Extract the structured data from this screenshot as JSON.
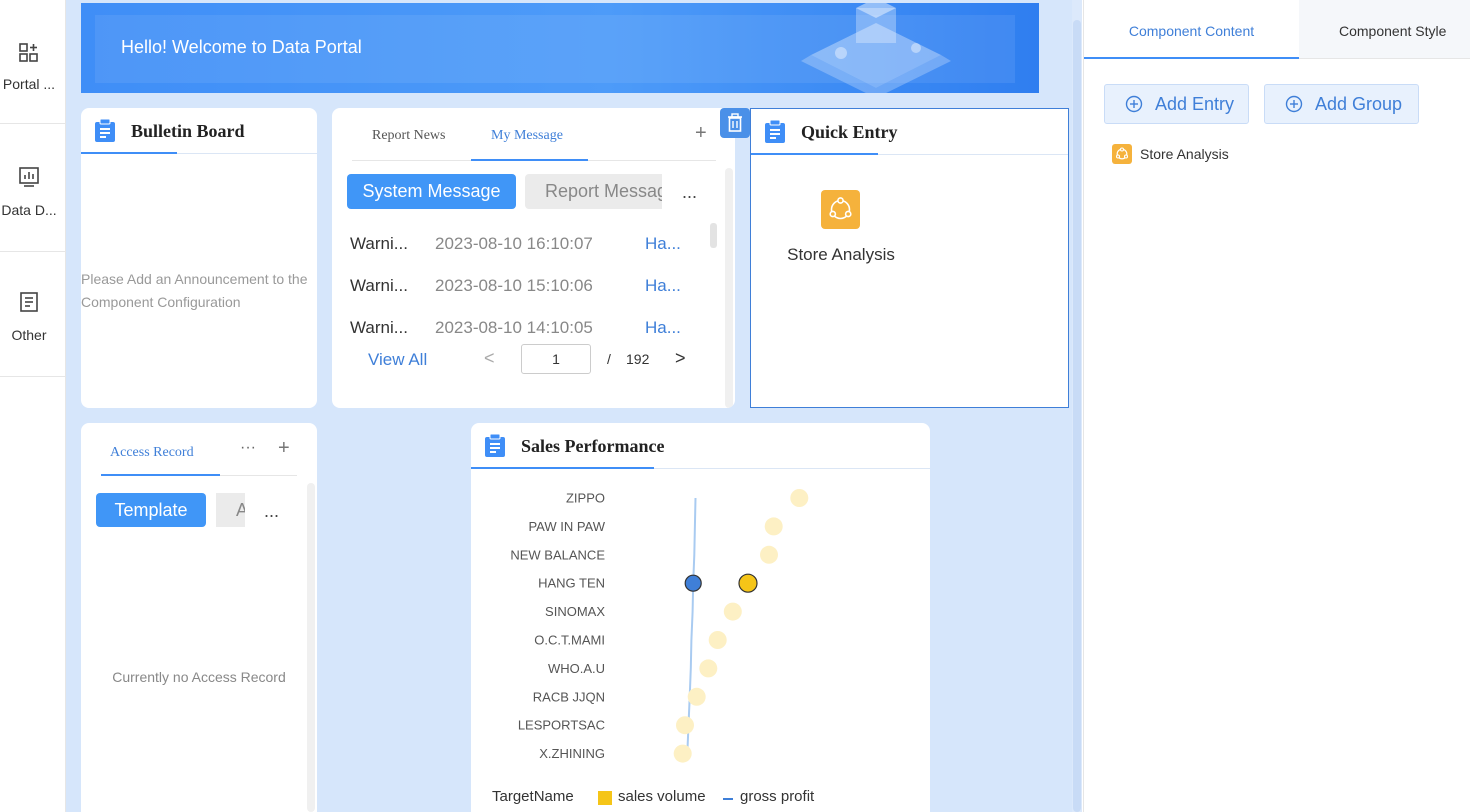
{
  "left_rail": {
    "items": [
      {
        "label": "Portal ...",
        "icon": "grid-plus-icon"
      },
      {
        "label": "Data D...",
        "icon": "bar-chart-icon"
      },
      {
        "label": "Other",
        "icon": "document-icon"
      }
    ]
  },
  "banner": {
    "title": "Hello! Welcome to Data Portal"
  },
  "bulletin": {
    "title": "Bulletin Board",
    "empty_text": "Please Add an Announcement to the Component Configuration"
  },
  "messages": {
    "tabs": [
      "Report News",
      "My Message"
    ],
    "active_tab": "My Message",
    "add_label": "+",
    "sub_buttons": [
      "System Message",
      "Report Message"
    ],
    "more_label": "...",
    "rows": [
      {
        "type": "Warni...",
        "time": "2023-08-10 16:10:07",
        "link": "Ha..."
      },
      {
        "type": "Warni...",
        "time": "2023-08-10 15:10:06",
        "link": "Ha..."
      },
      {
        "type": "Warni...",
        "time": "2023-08-10 14:10:05",
        "link": "Ha..."
      }
    ],
    "view_all": "View All",
    "pager": {
      "prev": "<",
      "current": "1",
      "slash": "/",
      "total": "192",
      "next": ">"
    }
  },
  "quick_entry": {
    "title": "Quick Entry",
    "tile_label": "Store Analysis",
    "tile_color": "#f5b23c"
  },
  "access_record": {
    "tab": "Access Record",
    "more_label": "···",
    "add_label": "+",
    "btn_template": "Template",
    "btn_other": "A",
    "btn_more": "...",
    "empty_text": "Currently no Access Record"
  },
  "sales": {
    "title": "Sales Performance",
    "legend": {
      "target": "TargetName",
      "sales": "sales volume",
      "profit": "gross profit"
    }
  },
  "chart_data": {
    "type": "scatter",
    "categories": [
      "ZIPPO",
      "PAW IN PAW",
      "NEW BALANCE",
      "HANG TEN",
      "SINOMAX",
      "O.C.T.MAMI",
      "WHO.A.U",
      "RACB JJQN",
      "LESPORTSAC",
      "X.ZHINING"
    ],
    "series": [
      {
        "name": "sales volume",
        "values": [
          100,
          78,
          74,
          56,
          43,
          30,
          22,
          12,
          2,
          0
        ],
        "color": "#f5c518"
      },
      {
        "name": "gross profit",
        "values": [
          11,
          10.5,
          10,
          9,
          8.5,
          7.5,
          7,
          6,
          5,
          4
        ],
        "color": "#3f7fd8"
      }
    ],
    "highlight_category": "HANG TEN",
    "xlim": [
      -10,
      110
    ],
    "legend_position": "bottom"
  },
  "right_panel": {
    "tabs": [
      "Component Content",
      "Component Style"
    ],
    "add_entry": "Add Entry",
    "add_group": "Add Group",
    "entry_label": "Store Analysis"
  },
  "colors": {
    "accent": "#3f8ef7",
    "canvas": "#d6e6fb",
    "tile": "#f5b23c"
  }
}
